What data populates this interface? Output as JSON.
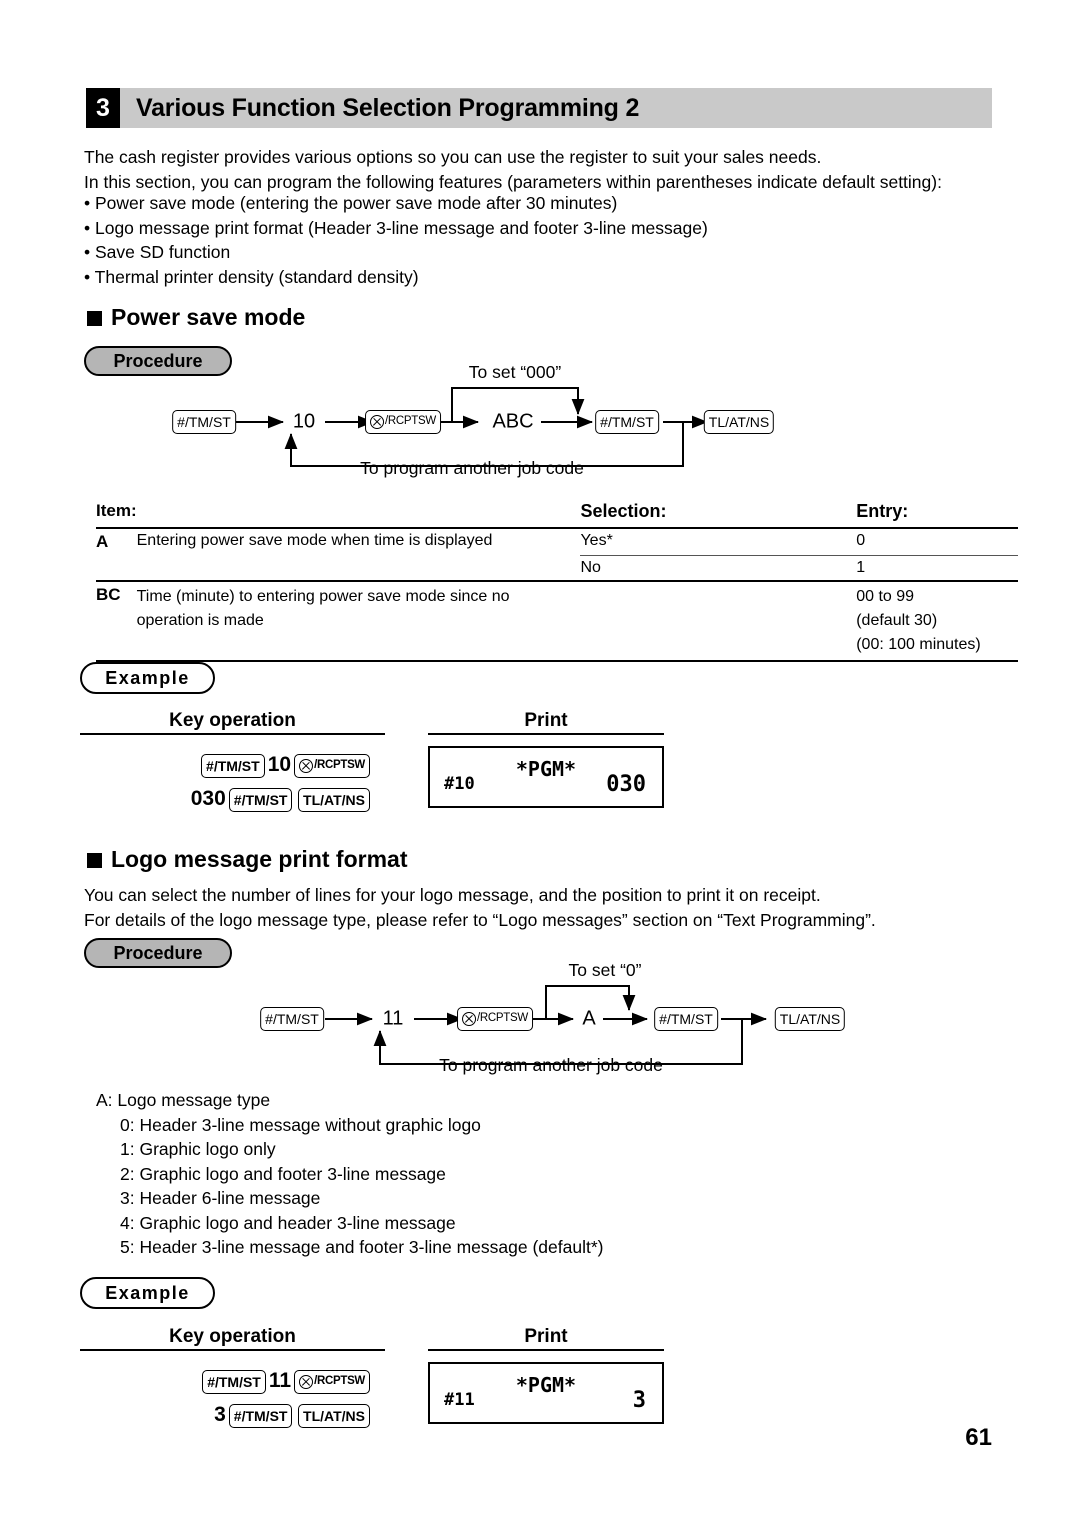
{
  "section": {
    "number": "3",
    "title": "Various Function Selection Programming 2"
  },
  "intro": {
    "line1": "The cash register provides various options so you can use the register to suit your sales needs.",
    "line2": "In this section, you can program the following features (parameters within parentheses indicate default setting):",
    "bullets": [
      "• Power save mode (entering the power save mode after 30 minutes)",
      "• Logo message print format (Header 3-line message and footer 3-line message)",
      "• Save SD function",
      "• Thermal printer density (standard density)"
    ]
  },
  "labels": {
    "procedure": "Procedure",
    "example": "Example",
    "key_operation": "Key operation",
    "print": "Print",
    "to_program_another": "To program another job code"
  },
  "power_save": {
    "heading": "Power save mode",
    "flow": {
      "caption_top": "To set “000”",
      "key1": "#/TM/ST",
      "code": "10",
      "key2_prefix": "",
      "key2": "/RCPTSW",
      "param": "ABC",
      "key3": "#/TM/ST",
      "key4": "TL/AT/NS",
      "caption_bottom": "To program another job code"
    },
    "table": {
      "headers": [
        "Item:",
        "",
        "Selection:",
        "Entry:"
      ],
      "rows": [
        {
          "item": "A",
          "desc": "Entering power save mode when time is displayed",
          "selections": [
            "Yes*",
            "No"
          ],
          "entries": [
            "0",
            "1"
          ]
        },
        {
          "item": "BC",
          "desc": "Time (minute) to entering power save mode since no operation is made",
          "selections": [
            ""
          ],
          "entries": [
            "00 to 99",
            "(default 30)",
            "(00: 100 minutes)"
          ]
        }
      ]
    },
    "example": {
      "keyops_line1_key1": "#/TM/ST",
      "keyops_line1_num": "10",
      "keyops_line1_key2": "/RCPTSW",
      "keyops_line2_num": "030",
      "keyops_line2_key1": "#/TM/ST",
      "keyops_line2_key2": "TL/AT/NS",
      "receipt_pgm": "*PGM*",
      "receipt_code": "#10",
      "receipt_value": "030"
    }
  },
  "logo_message": {
    "heading": "Logo message print format",
    "desc_line1": "You can select the number of lines for your logo message, and the position to print it on receipt.",
    "desc_line2": "For details of the logo message type, please refer to “Logo messages” section on “Text Programming”.",
    "flow": {
      "caption_top": "To set “0”",
      "key1": "#/TM/ST",
      "code": "11",
      "key2": "/RCPTSW",
      "param": "A",
      "key3": "#/TM/ST",
      "key4": "TL/AT/NS",
      "caption_bottom": "To program another job code"
    },
    "types": {
      "lead": "A: Logo message type",
      "options": [
        "0: Header 3-line message without graphic logo",
        "1: Graphic logo only",
        "2: Graphic logo and footer 3-line message",
        "3: Header 6-line message",
        "4: Graphic logo and header 3-line message",
        "5: Header 3-line message and footer 3-line message (default*)"
      ]
    },
    "example": {
      "keyops_line1_key1": "#/TM/ST",
      "keyops_line1_num": "11",
      "keyops_line1_key2": "/RCPTSW",
      "keyops_line2_num": "3",
      "keyops_line2_key1": "#/TM/ST",
      "keyops_line2_key2": "TL/AT/NS",
      "receipt_pgm": "*PGM*",
      "receipt_code": "#11",
      "receipt_value": "3"
    }
  },
  "footer": {
    "page_number": "61"
  },
  "colors": {
    "header_bar": "#c9c9c9",
    "badge_gray": "#b5b5b5",
    "ink": "#000000"
  }
}
